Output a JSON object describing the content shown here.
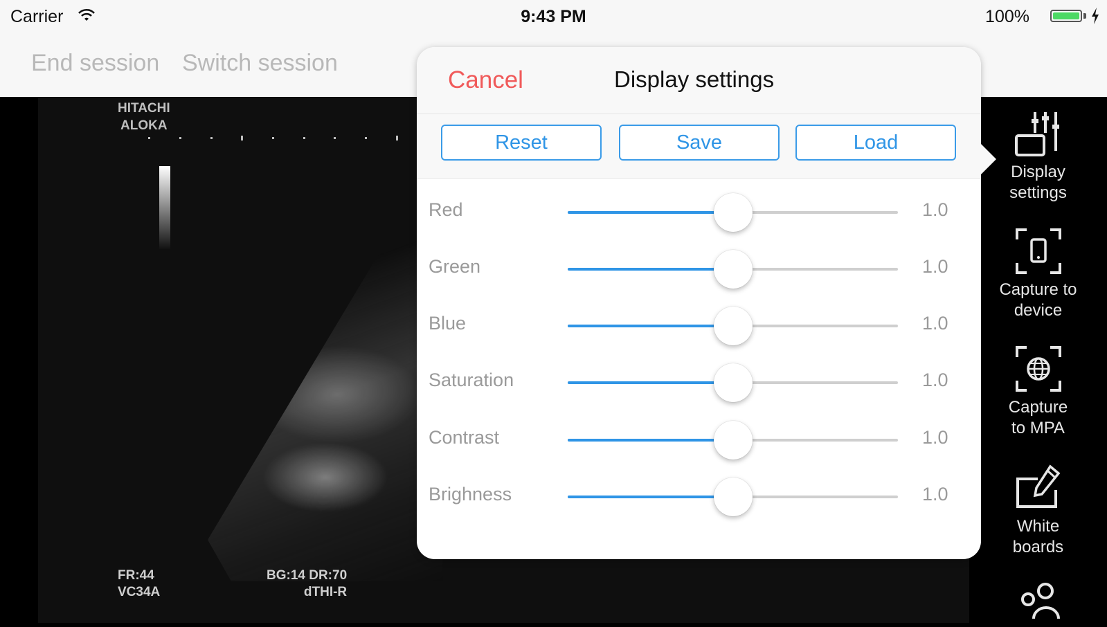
{
  "status_bar": {
    "carrier": "Carrier",
    "time": "9:43 PM",
    "battery": "100%",
    "battery_color": "#4cd964"
  },
  "nav": {
    "end_session": "End session",
    "switch_session": "Switch session"
  },
  "scan": {
    "brand_line1": "HITACHI",
    "brand_line2": "ALOKA",
    "fr": "FR:44",
    "probe": "VC34A",
    "bg_dr": "BG:14  DR:70",
    "mode": "dTHI-R"
  },
  "popover": {
    "cancel": "Cancel",
    "title": "Display settings",
    "buttons": {
      "reset": "Reset",
      "save": "Save",
      "load": "Load"
    },
    "sliders": [
      {
        "label": "Red",
        "value": "1.0",
        "level": 0.5
      },
      {
        "label": "Green",
        "value": "1.0",
        "level": 0.5
      },
      {
        "label": "Blue",
        "value": "1.0",
        "level": 0.5
      },
      {
        "label": "Saturation",
        "value": "1.0",
        "level": 0.5
      },
      {
        "label": "Contrast",
        "value": "1.0",
        "level": 0.5
      },
      {
        "label": "Brighness",
        "value": "1.0",
        "level": 0.5
      }
    ],
    "accent_color": "#2f95e6",
    "cancel_color": "#f05a5a"
  },
  "toolbar": {
    "items": [
      {
        "label": "Display settings",
        "icon": "display-settings-icon"
      },
      {
        "label": "Capture to device",
        "icon": "capture-device-icon"
      },
      {
        "label": "Capture to MPA",
        "icon": "capture-mpa-icon"
      },
      {
        "label": "White boards",
        "icon": "whiteboard-icon"
      },
      {
        "label": "",
        "icon": "users-icon"
      }
    ]
  }
}
